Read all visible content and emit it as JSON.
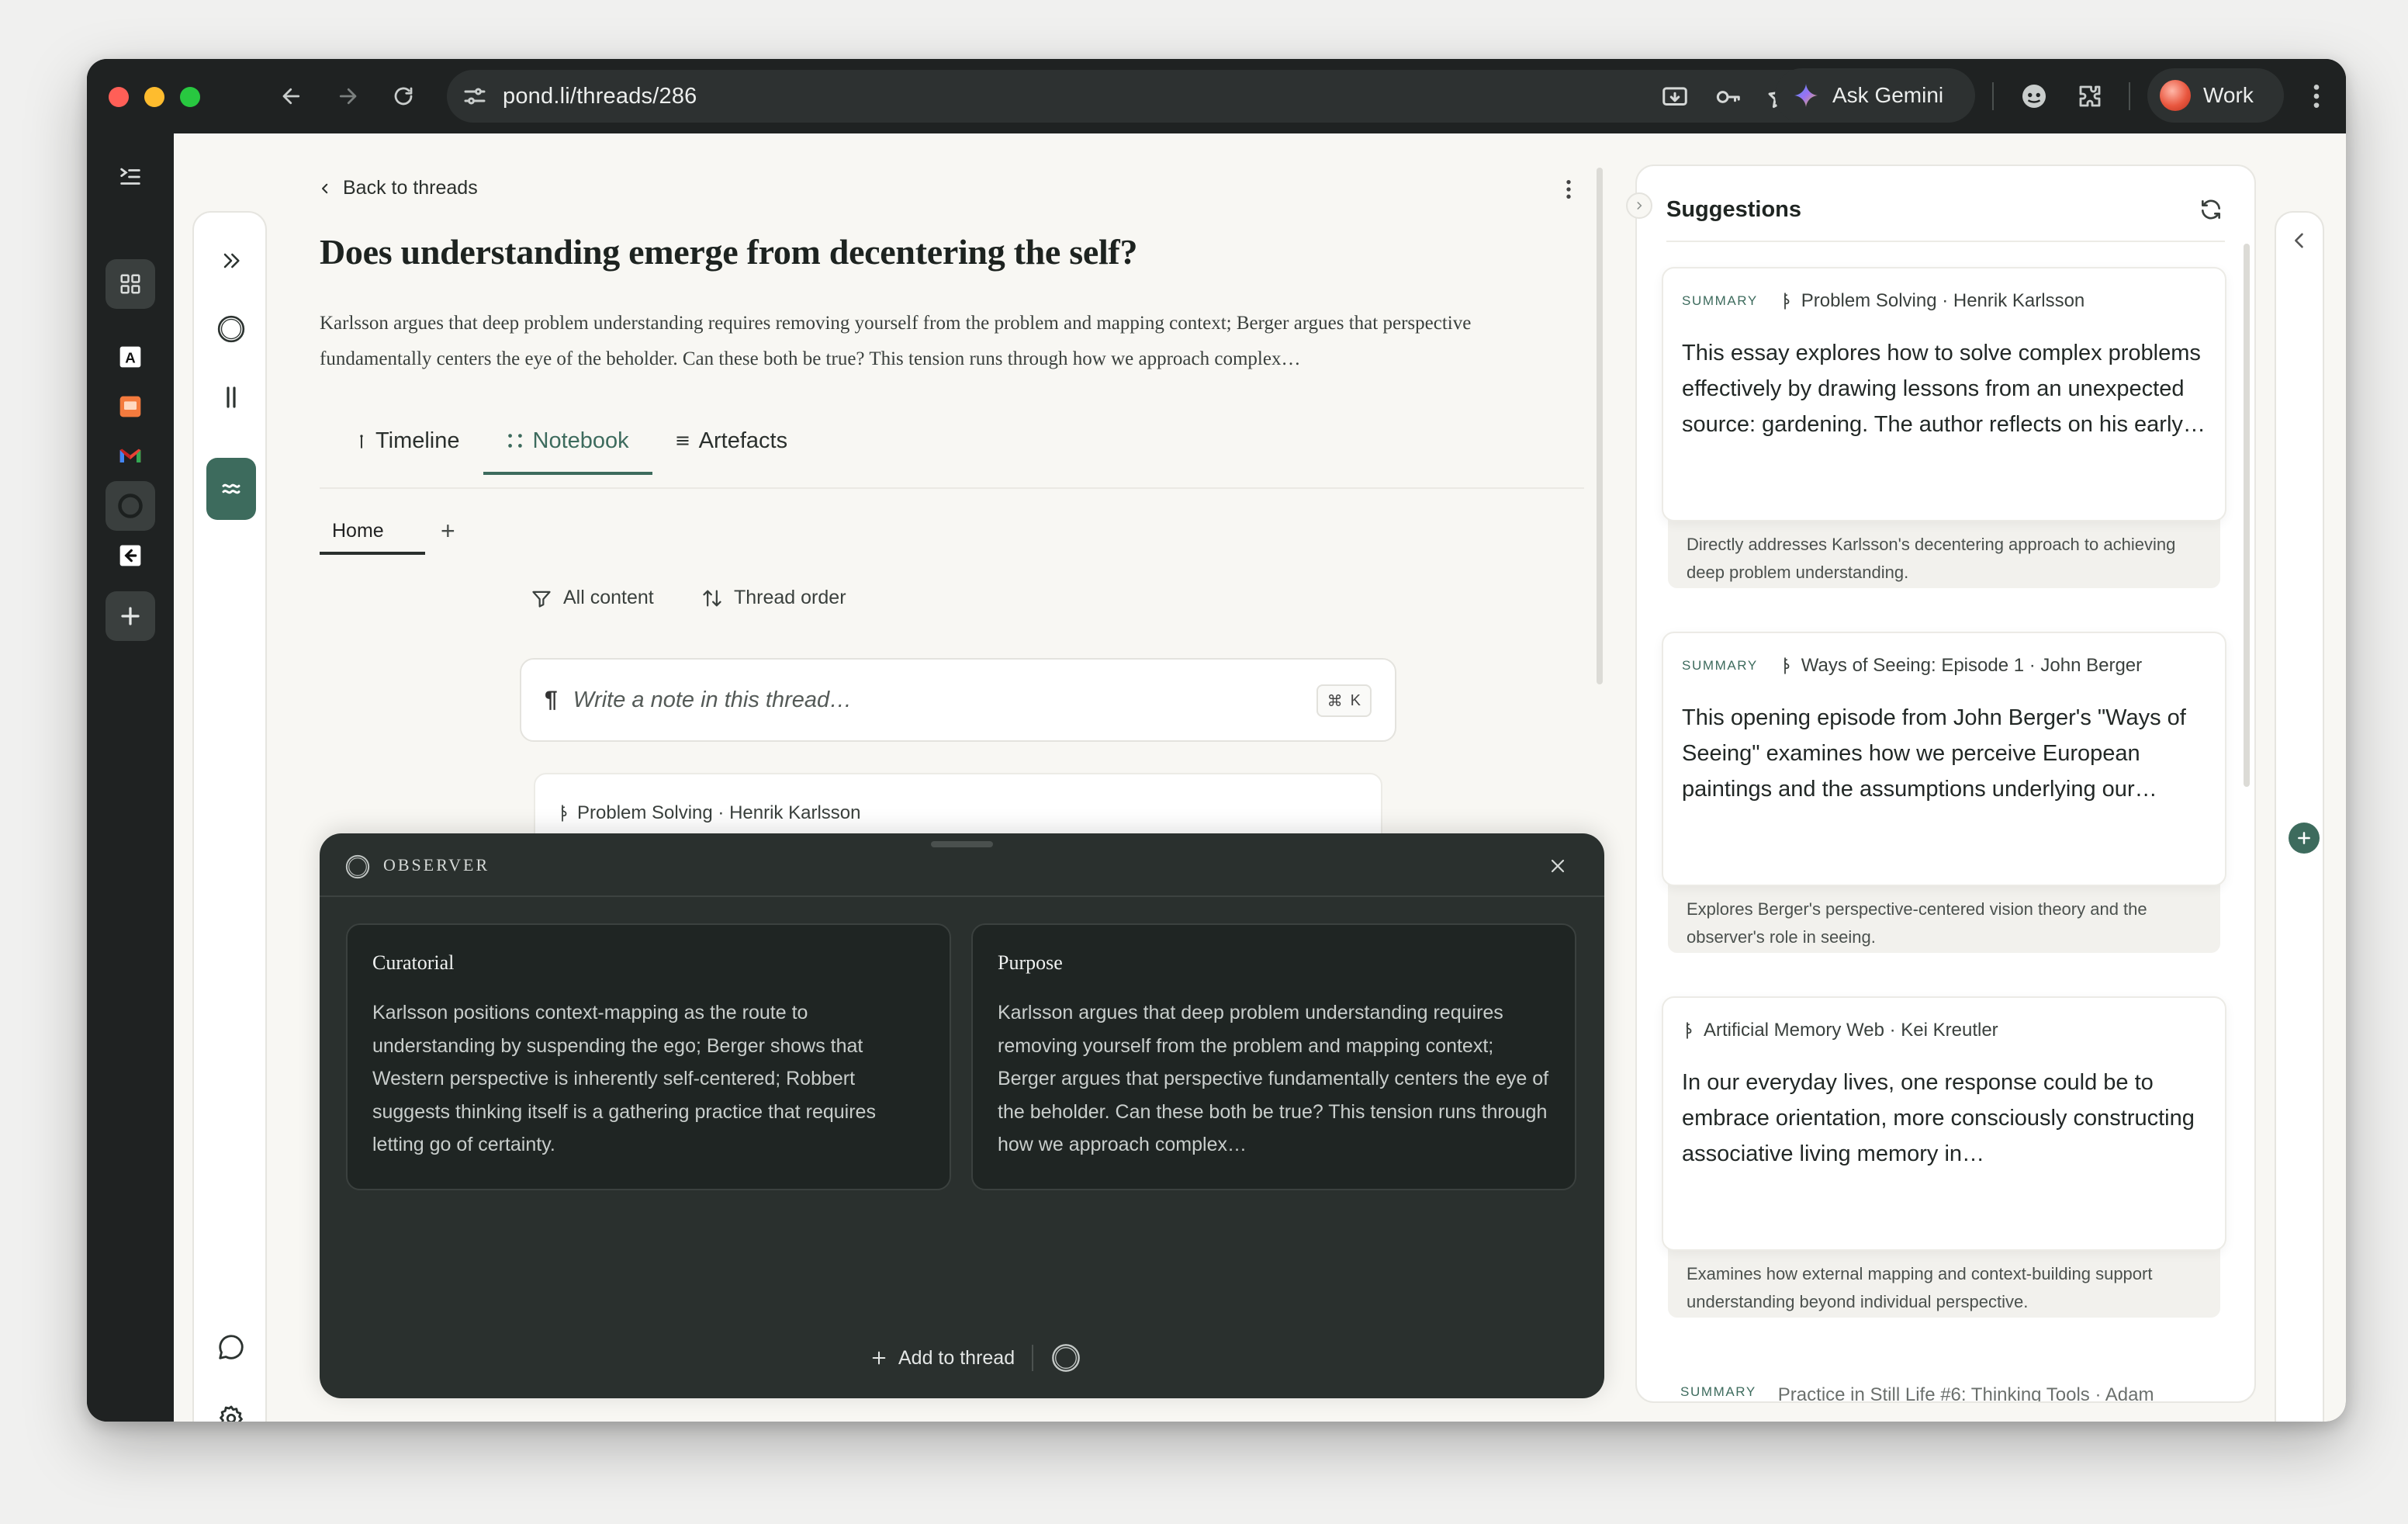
{
  "browser": {
    "url": "pond.li/threads/286",
    "gemini_label": "Ask Gemini",
    "profile_label": "Work"
  },
  "rail": {
    "items": [
      {
        "icon": "sidebar-toggle-icon"
      },
      {
        "icon": "grid-icon"
      },
      {
        "icon": "app-a-icon"
      },
      {
        "icon": "app-slides-icon"
      },
      {
        "icon": "gmail-icon"
      },
      {
        "icon": "pond-app-icon"
      },
      {
        "icon": "app-export-icon"
      },
      {
        "icon": "add-icon"
      }
    ]
  },
  "thread": {
    "back_label": "Back to threads",
    "title": "Does understanding emerge from decentering the self?",
    "description": "Karlsson argues that deep problem understanding requires removing yourself from the problem and mapping context; Berger argues that perspective fundamentally centers the eye of the beholder. Can these both be true? This tension runs through how we approach complex…",
    "tabs": [
      {
        "label": "Timeline",
        "icon": "timeline-icon"
      },
      {
        "label": "Notebook",
        "icon": "notebook-icon"
      },
      {
        "label": "Artefacts",
        "icon": "artefacts-icon"
      }
    ],
    "subtab": "Home",
    "subtab_add": "+",
    "filters": {
      "content": "All content",
      "order": "Thread order"
    },
    "note_placeholder": "Write a note in this thread…",
    "note_shortcut": {
      "cmd": "⌘",
      "key": "K"
    },
    "peek_card_label": "Problem Solving · Henrik Karlsson"
  },
  "observer": {
    "title": "OBSERVER",
    "cards": [
      {
        "title": "Curatorial",
        "body": "Karlsson positions context-mapping as the route to understanding by suspending the ego; Berger shows that Western perspective is inherently self-centered; Robbert suggests thinking itself is a gathering practice that requires letting go of certainty."
      },
      {
        "title": "Purpose",
        "body": "Karlsson argues that deep problem understanding requires removing yourself from the problem and mapping context; Berger argues that perspective fundamentally centers the eye of the beholder. Can these both be true? This tension runs through how we approach complex…"
      }
    ],
    "add_label": "Add to thread"
  },
  "suggestions": {
    "title": "Suggestions",
    "items": [
      {
        "badge": "SUMMARY",
        "source": "Problem Solving · Henrik Karlsson",
        "text": "This essay explores how to solve complex problems effectively by drawing lessons from an unexpected source: gardening. The author reflects on his early…",
        "reason": "Directly addresses Karlsson's decentering approach to achieving deep problem understanding."
      },
      {
        "badge": "SUMMARY",
        "source": "Ways of Seeing: Episode 1 · John Berger",
        "text": "This opening episode from John Berger's \"Ways of Seeing\" examines how we perceive European paintings and the assumptions underlying our…",
        "reason": "Explores Berger's perspective-centered vision theory and the observer's role in seeing."
      },
      {
        "badge": "",
        "source": "Artificial Memory Web · Kei Kreutler",
        "text": "In our everyday lives, one response could be to embrace orientation, more consciously constructing associative living memory in…",
        "reason": "Examines how external mapping and context-building support understanding beyond individual perspective."
      }
    ],
    "peek": {
      "badge": "SUMMARY",
      "source": "Practice in Still Life #6: Thinking Tools · Adam"
    }
  },
  "colors": {
    "accent": "#3d6b5d",
    "observer_bg": "#2a302e",
    "page_bg": "#f8f7f3"
  }
}
